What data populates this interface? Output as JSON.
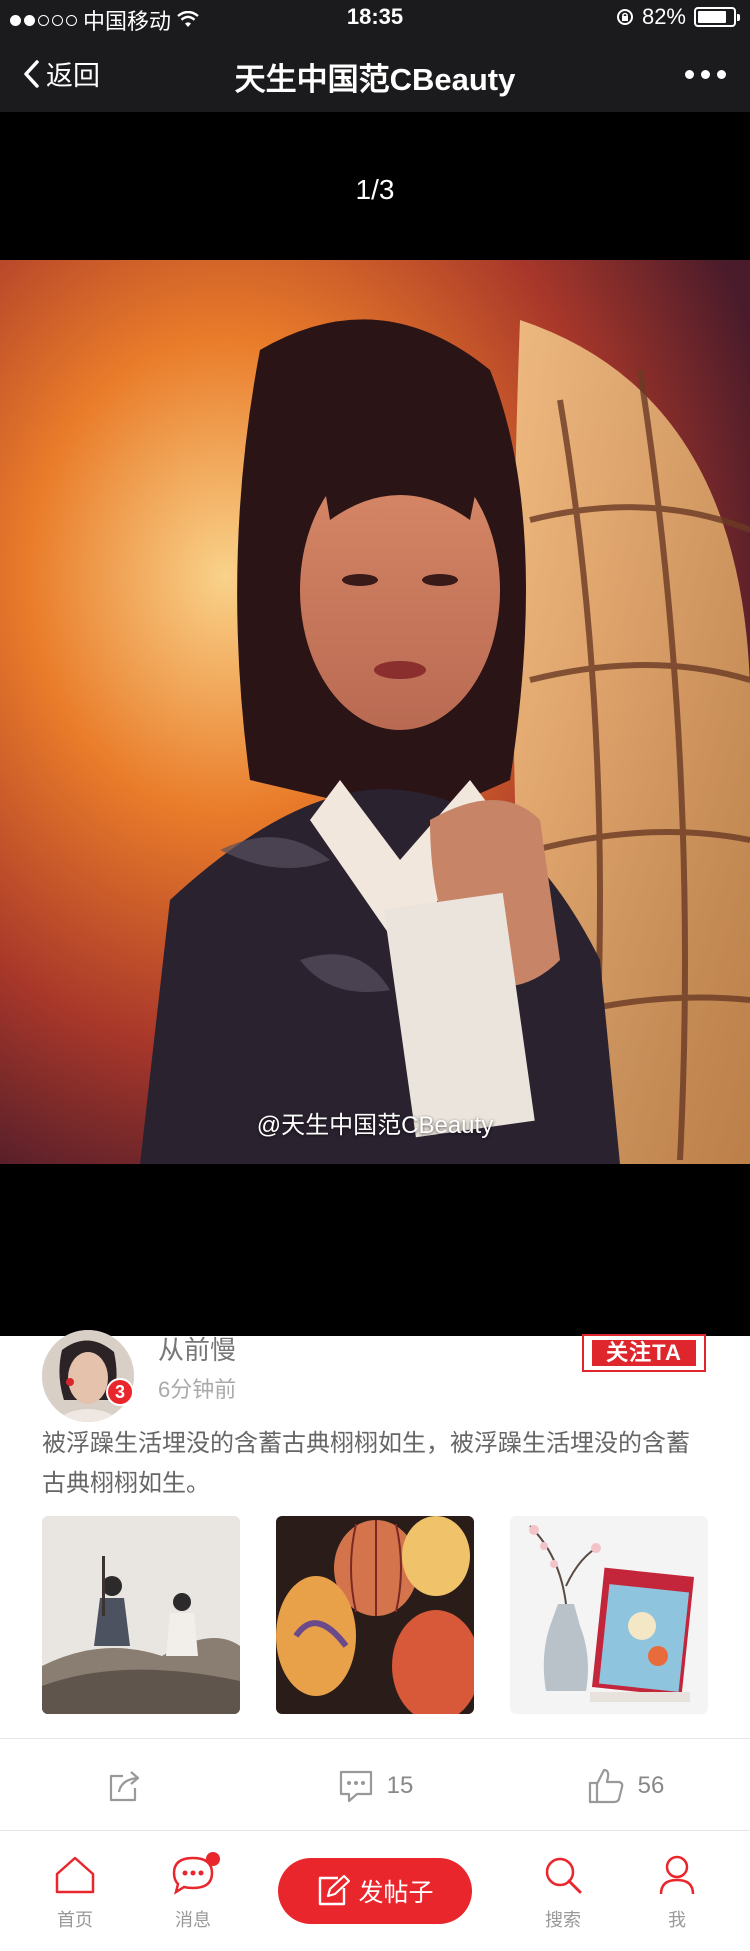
{
  "status_bar": {
    "carrier": "中国移动",
    "time": "18:35",
    "battery_percent": "82%",
    "battery_level": 0.82
  },
  "nav": {
    "back_label": "返回",
    "title": "天生中国范CBeauty"
  },
  "viewer": {
    "counter": "1/3",
    "watermark": "@天生中国范CBeauty"
  },
  "post": {
    "username": "从前慢",
    "time": "6分钟前",
    "avatar_badge": "3",
    "follow_label": "关注TA",
    "text": "被浮躁生活埋没的含蓄古典栩栩如生，被浮躁生活埋没的含蓄古典栩栩如生。",
    "actions": {
      "comment_count": "15",
      "like_count": "56"
    }
  },
  "tabs": {
    "home": "首页",
    "messages": "消息",
    "post": "发帖子",
    "search": "搜索",
    "me": "我"
  },
  "colors": {
    "accent": "#e8262c",
    "nav_background": "#1b1b1d"
  }
}
